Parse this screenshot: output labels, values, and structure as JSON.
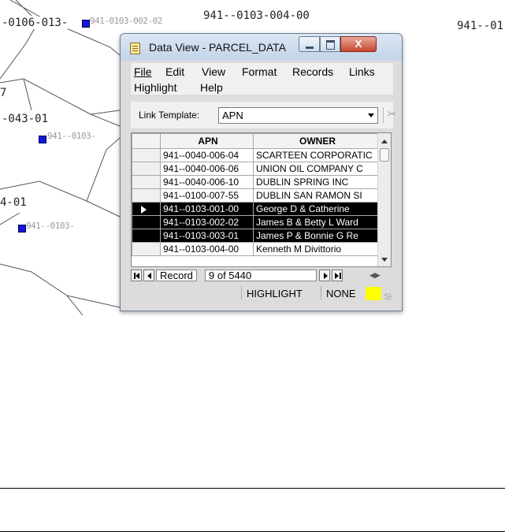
{
  "map": {
    "labels": [
      "-0106-013-",
      "941--0103-004-00",
      "941--01",
      "-043-01",
      "7",
      "4-01"
    ],
    "dashed_labels": [
      "941-0103-002-02",
      "941--0103-",
      "941--0103-"
    ]
  },
  "window": {
    "title": "Data View - PARCEL_DATA",
    "close_glyph": "X",
    "menu": [
      "File",
      "Edit",
      "View",
      "Format",
      "Records",
      "Links",
      "Highlight",
      "Help"
    ],
    "link_template": {
      "label": "Link Template:",
      "value": "APN"
    },
    "grid": {
      "columns": [
        "APN",
        "OWNER"
      ],
      "rows": [
        {
          "apn": "941--0040-006-04",
          "owner": "SCARTEEN CORPORATIC"
        },
        {
          "apn": "941--0040-006-06",
          "owner": "UNION OIL COMPANY C"
        },
        {
          "apn": "941--0040-006-10",
          "owner": "DUBLIN SPRING INC"
        },
        {
          "apn": "941--0100-007-55",
          "owner": "DUBLIN SAN RAMON SI"
        },
        {
          "apn": "941--0103-001-00",
          "owner": "George D & Catherine"
        },
        {
          "apn": "941--0103-002-02",
          "owner": "James B & Betty L Ward"
        },
        {
          "apn": "941--0103-003-01",
          "owner": "James P & Bonnie G Re"
        },
        {
          "apn": "941--0103-004-00",
          "owner": "Kenneth M Divittorio"
        }
      ],
      "highlighted_rows": [
        4,
        5,
        6
      ],
      "current_row": 4
    },
    "nav": {
      "label": "Record",
      "value": "9 of 5440"
    },
    "status": {
      "highlight": "HIGHLIGHT",
      "mode": "NONE",
      "swatch_color": "#ffff00"
    }
  }
}
